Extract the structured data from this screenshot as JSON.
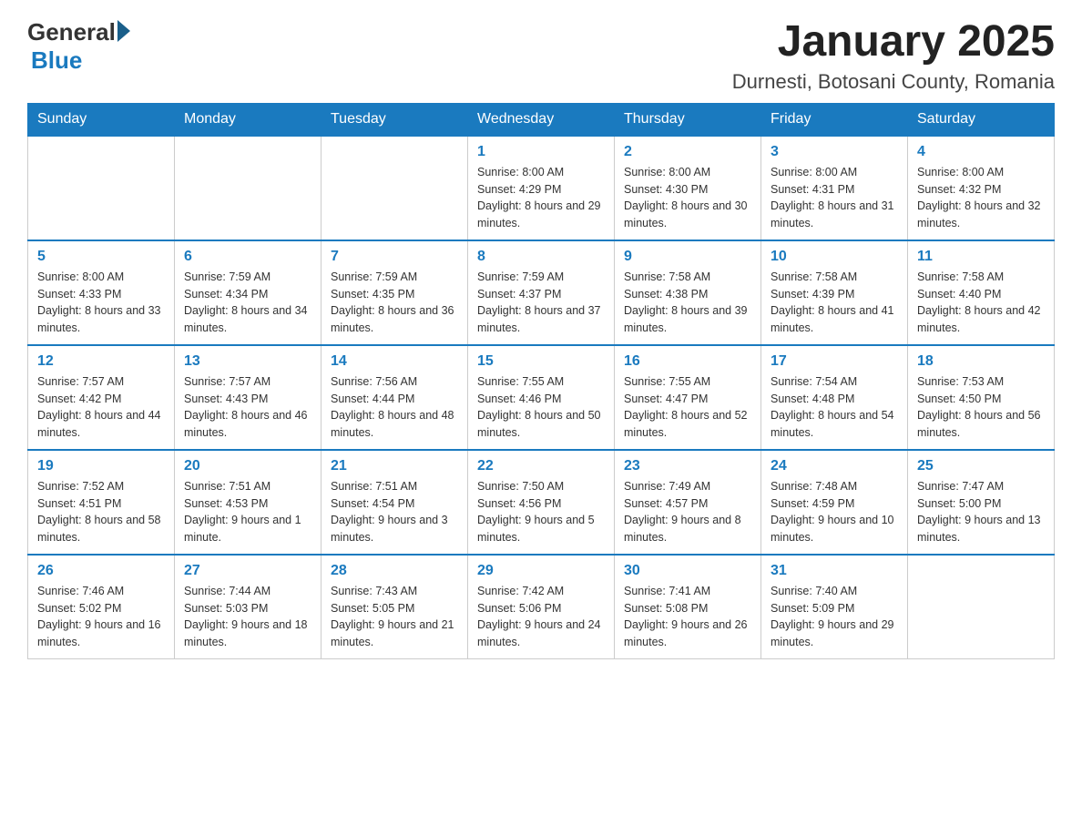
{
  "header": {
    "logo_general": "General",
    "logo_blue": "Blue",
    "title": "January 2025",
    "subtitle": "Durnesti, Botosani County, Romania"
  },
  "weekdays": [
    "Sunday",
    "Monday",
    "Tuesday",
    "Wednesday",
    "Thursday",
    "Friday",
    "Saturday"
  ],
  "weeks": [
    [
      {
        "day": "",
        "info": ""
      },
      {
        "day": "",
        "info": ""
      },
      {
        "day": "",
        "info": ""
      },
      {
        "day": "1",
        "info": "Sunrise: 8:00 AM\nSunset: 4:29 PM\nDaylight: 8 hours\nand 29 minutes."
      },
      {
        "day": "2",
        "info": "Sunrise: 8:00 AM\nSunset: 4:30 PM\nDaylight: 8 hours\nand 30 minutes."
      },
      {
        "day": "3",
        "info": "Sunrise: 8:00 AM\nSunset: 4:31 PM\nDaylight: 8 hours\nand 31 minutes."
      },
      {
        "day": "4",
        "info": "Sunrise: 8:00 AM\nSunset: 4:32 PM\nDaylight: 8 hours\nand 32 minutes."
      }
    ],
    [
      {
        "day": "5",
        "info": "Sunrise: 8:00 AM\nSunset: 4:33 PM\nDaylight: 8 hours\nand 33 minutes."
      },
      {
        "day": "6",
        "info": "Sunrise: 7:59 AM\nSunset: 4:34 PM\nDaylight: 8 hours\nand 34 minutes."
      },
      {
        "day": "7",
        "info": "Sunrise: 7:59 AM\nSunset: 4:35 PM\nDaylight: 8 hours\nand 36 minutes."
      },
      {
        "day": "8",
        "info": "Sunrise: 7:59 AM\nSunset: 4:37 PM\nDaylight: 8 hours\nand 37 minutes."
      },
      {
        "day": "9",
        "info": "Sunrise: 7:58 AM\nSunset: 4:38 PM\nDaylight: 8 hours\nand 39 minutes."
      },
      {
        "day": "10",
        "info": "Sunrise: 7:58 AM\nSunset: 4:39 PM\nDaylight: 8 hours\nand 41 minutes."
      },
      {
        "day": "11",
        "info": "Sunrise: 7:58 AM\nSunset: 4:40 PM\nDaylight: 8 hours\nand 42 minutes."
      }
    ],
    [
      {
        "day": "12",
        "info": "Sunrise: 7:57 AM\nSunset: 4:42 PM\nDaylight: 8 hours\nand 44 minutes."
      },
      {
        "day": "13",
        "info": "Sunrise: 7:57 AM\nSunset: 4:43 PM\nDaylight: 8 hours\nand 46 minutes."
      },
      {
        "day": "14",
        "info": "Sunrise: 7:56 AM\nSunset: 4:44 PM\nDaylight: 8 hours\nand 48 minutes."
      },
      {
        "day": "15",
        "info": "Sunrise: 7:55 AM\nSunset: 4:46 PM\nDaylight: 8 hours\nand 50 minutes."
      },
      {
        "day": "16",
        "info": "Sunrise: 7:55 AM\nSunset: 4:47 PM\nDaylight: 8 hours\nand 52 minutes."
      },
      {
        "day": "17",
        "info": "Sunrise: 7:54 AM\nSunset: 4:48 PM\nDaylight: 8 hours\nand 54 minutes."
      },
      {
        "day": "18",
        "info": "Sunrise: 7:53 AM\nSunset: 4:50 PM\nDaylight: 8 hours\nand 56 minutes."
      }
    ],
    [
      {
        "day": "19",
        "info": "Sunrise: 7:52 AM\nSunset: 4:51 PM\nDaylight: 8 hours\nand 58 minutes."
      },
      {
        "day": "20",
        "info": "Sunrise: 7:51 AM\nSunset: 4:53 PM\nDaylight: 9 hours\nand 1 minute."
      },
      {
        "day": "21",
        "info": "Sunrise: 7:51 AM\nSunset: 4:54 PM\nDaylight: 9 hours\nand 3 minutes."
      },
      {
        "day": "22",
        "info": "Sunrise: 7:50 AM\nSunset: 4:56 PM\nDaylight: 9 hours\nand 5 minutes."
      },
      {
        "day": "23",
        "info": "Sunrise: 7:49 AM\nSunset: 4:57 PM\nDaylight: 9 hours\nand 8 minutes."
      },
      {
        "day": "24",
        "info": "Sunrise: 7:48 AM\nSunset: 4:59 PM\nDaylight: 9 hours\nand 10 minutes."
      },
      {
        "day": "25",
        "info": "Sunrise: 7:47 AM\nSunset: 5:00 PM\nDaylight: 9 hours\nand 13 minutes."
      }
    ],
    [
      {
        "day": "26",
        "info": "Sunrise: 7:46 AM\nSunset: 5:02 PM\nDaylight: 9 hours\nand 16 minutes."
      },
      {
        "day": "27",
        "info": "Sunrise: 7:44 AM\nSunset: 5:03 PM\nDaylight: 9 hours\nand 18 minutes."
      },
      {
        "day": "28",
        "info": "Sunrise: 7:43 AM\nSunset: 5:05 PM\nDaylight: 9 hours\nand 21 minutes."
      },
      {
        "day": "29",
        "info": "Sunrise: 7:42 AM\nSunset: 5:06 PM\nDaylight: 9 hours\nand 24 minutes."
      },
      {
        "day": "30",
        "info": "Sunrise: 7:41 AM\nSunset: 5:08 PM\nDaylight: 9 hours\nand 26 minutes."
      },
      {
        "day": "31",
        "info": "Sunrise: 7:40 AM\nSunset: 5:09 PM\nDaylight: 9 hours\nand 29 minutes."
      },
      {
        "day": "",
        "info": ""
      }
    ]
  ]
}
